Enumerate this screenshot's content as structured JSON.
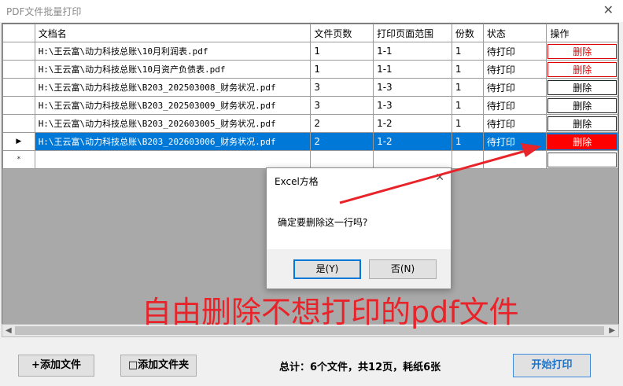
{
  "window": {
    "title": "PDF文件批量打印",
    "close_glyph": "✕"
  },
  "table": {
    "columns": [
      "文档名",
      "文件页数",
      "打印页面范围",
      "份数",
      "状态",
      "操作"
    ],
    "rows": [
      {
        "marker": "",
        "name": "H:\\王云富\\动力科技总账\\10月利润表.pdf",
        "pages": "1",
        "range": "1-1",
        "copies": "1",
        "status": "待打印",
        "action": "删除"
      },
      {
        "marker": "",
        "name": "H:\\王云富\\动力科技总账\\10月资产负债表.pdf",
        "pages": "1",
        "range": "1-1",
        "copies": "1",
        "status": "待打印",
        "action": "删除"
      },
      {
        "marker": "",
        "name": "H:\\王云富\\动力科技总账\\B203_202503008_财务状况.pdf",
        "pages": "3",
        "range": "1-3",
        "copies": "1",
        "status": "待打印",
        "action": "删除"
      },
      {
        "marker": "",
        "name": "H:\\王云富\\动力科技总账\\B203_202503009_财务状况.pdf",
        "pages": "3",
        "range": "1-3",
        "copies": "1",
        "status": "待打印",
        "action": "删除"
      },
      {
        "marker": "",
        "name": "H:\\王云富\\动力科技总账\\B203_202603005_财务状况.pdf",
        "pages": "2",
        "range": "1-2",
        "copies": "1",
        "status": "待打印",
        "action": "删除"
      },
      {
        "marker": "▶",
        "name": "H:\\王云富\\动力科技总账\\B203_202603006_财务状况.pdf",
        "pages": "2",
        "range": "1-2",
        "copies": "1",
        "status": "待打印",
        "action": "删除"
      }
    ],
    "new_row_marker": "*"
  },
  "scrollbar": {
    "left": "◀",
    "right": "▶"
  },
  "buttons": {
    "add_file": "+添加文件",
    "add_folder": "□添加文件夹",
    "start_print": "开始打印"
  },
  "summary": "总计：6个文件，共12页，耗纸6张",
  "dialog": {
    "title": "Excel方格",
    "close_glyph": "✕",
    "message": "确定要删除这一行吗?",
    "yes": "是(Y)",
    "no": "否(N)"
  },
  "caption": "自由删除不想打印的pdf文件",
  "colors": {
    "selection": "#0078d7",
    "delete_red": "#ff0000",
    "annotation_red": "#e8242a"
  }
}
